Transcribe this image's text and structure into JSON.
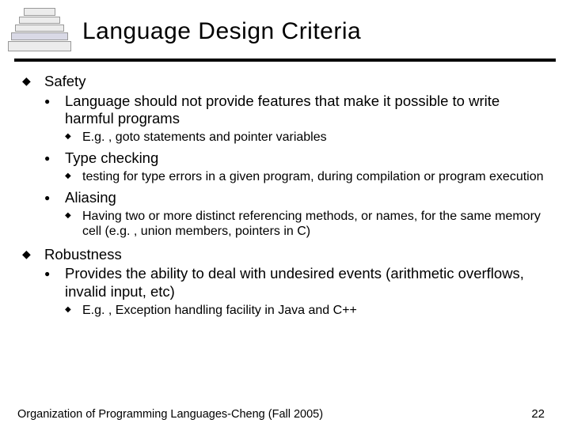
{
  "title": "Language Design Criteria",
  "bullets": {
    "safety": {
      "label": "Safety",
      "sub": {
        "lang": {
          "label": "Language should not provide features that make it possible to write harmful programs",
          "ex": "E.g. , goto statements and pointer variables"
        },
        "typechk": {
          "label": "Type checking",
          "ex": "testing for type errors in a given program, during compilation or program execution"
        },
        "alias": {
          "label": "Aliasing",
          "ex": "Having two or more distinct referencing methods, or names, for the same memory cell (e.g. , union members, pointers in C)"
        }
      }
    },
    "robust": {
      "label": "Robustness",
      "sub": {
        "prov": {
          "label": "Provides the ability to deal with undesired events (arithmetic overflows, invalid input, etc)",
          "ex": "E.g. , Exception handling facility in Java and C++"
        }
      }
    }
  },
  "footer": {
    "course": "Organization of Programming Languages-Cheng (Fall 2005)",
    "page": "22"
  }
}
